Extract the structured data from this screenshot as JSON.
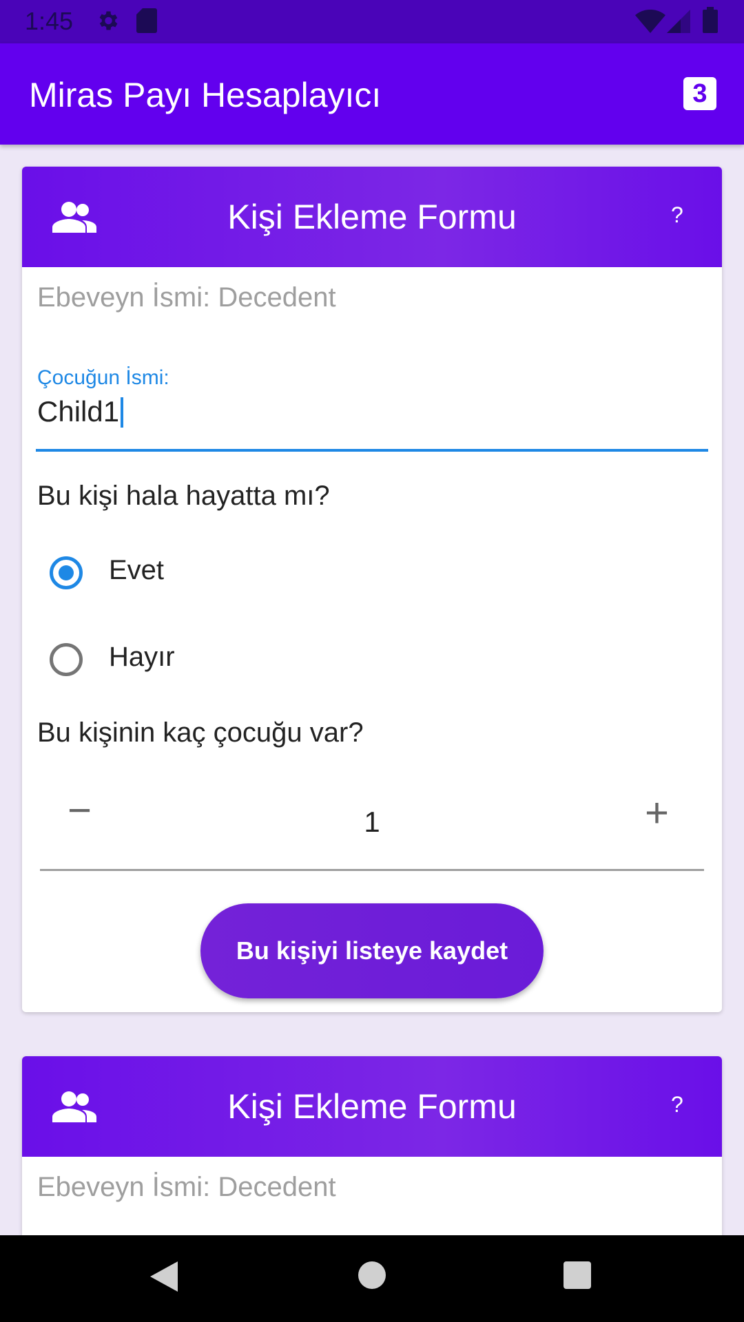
{
  "statusbar": {
    "time": "1:45"
  },
  "appbar": {
    "title": "Miras Payı Hesaplayıcı",
    "badge": "3"
  },
  "form1": {
    "header_title": "Kişi Ekleme Formu",
    "help": "?",
    "parent_label": "Ebeveyn İsmi: Decedent",
    "child_name_label": "Çocuğun İsmi:",
    "child_name_value": "Child1",
    "alive_question": "Bu kişi hala hayatta mı?",
    "alive_options": [
      {
        "label": "Evet",
        "selected": true
      },
      {
        "label": "Hayır",
        "selected": false
      }
    ],
    "children_question": "Bu kişinin kaç çocuğu var?",
    "children_count": "1",
    "minus": "−",
    "plus": "+",
    "save_label": "Bu kişiyi listeye kaydet"
  },
  "form2": {
    "header_title": "Kişi Ekleme Formu",
    "help": "?",
    "parent_label": "Ebeveyn İsmi: Decedent"
  },
  "colors": {
    "primary": "#6200EE",
    "status_bar": "#4A04B8",
    "accent_blue": "#1E88E5",
    "background": "#EDE7F6"
  }
}
